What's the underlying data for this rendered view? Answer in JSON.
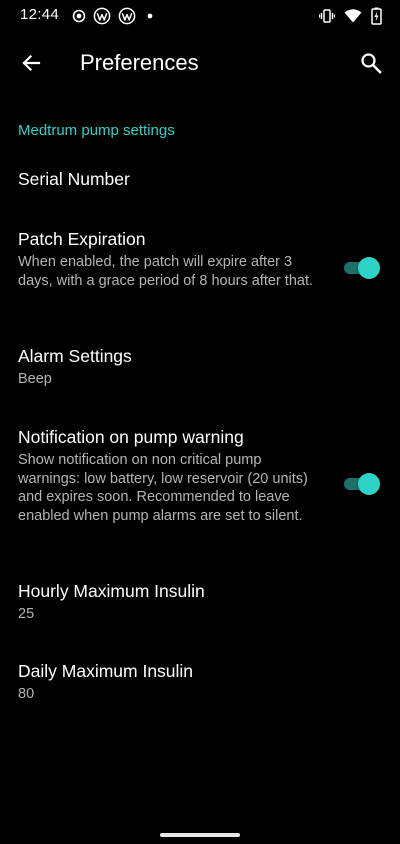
{
  "status_bar": {
    "time": "12:44",
    "left_icons": [
      "record-icon",
      "wordpress-icon",
      "wordpress-icon",
      "dot-icon"
    ],
    "right_icons": [
      "vibrate-icon",
      "wifi-icon",
      "battery-charging-icon"
    ]
  },
  "app_bar": {
    "title": "Preferences",
    "back_icon": "arrow-back-icon",
    "search_icon": "search-icon"
  },
  "category": {
    "label": "Medtrum pump settings",
    "color": "#2ed3c6"
  },
  "preferences": [
    {
      "title": "Serial Number",
      "summary": ""
    },
    {
      "title": "Patch Expiration",
      "summary": "When enabled, the patch will expire after 3 days, with a grace period of 8 hours after that.",
      "toggle": true
    },
    {
      "title": "Alarm Settings",
      "summary": "Beep"
    },
    {
      "title": "Notification on pump warning",
      "summary": "Show notification on non critical pump warnings: low battery, low reservoir (20 units) and expires soon. Recommended to leave enabled when pump alarms are set to silent.",
      "toggle": true
    },
    {
      "title": "Hourly Maximum Insulin",
      "summary": "25"
    },
    {
      "title": "Daily Maximum Insulin",
      "summary": "80"
    }
  ],
  "colors": {
    "background": "#000000",
    "accent": "#2ed3c6",
    "primary_text": "#ffffff",
    "secondary_text": "#b4b4b4"
  }
}
